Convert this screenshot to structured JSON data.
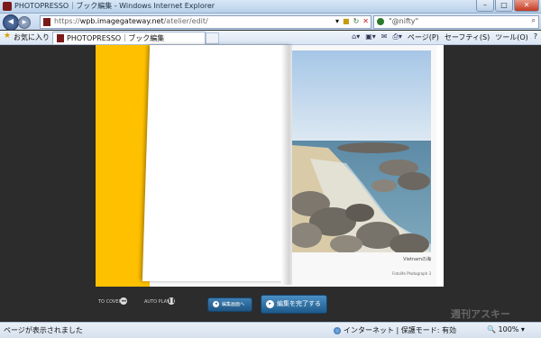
{
  "window": {
    "title": "PHOTOPRESSO｜ブック編集 - Windows Internet Explorer",
    "min_label": "–",
    "max_label": "□",
    "close_label": "✕"
  },
  "address": {
    "url_prefix": "https://",
    "url_domain": "wpb.imagegateway.net",
    "url_path": "/atelier/edit/"
  },
  "search": {
    "placeholder": "\"@nifty\""
  },
  "favorites": {
    "label": "お気に入り"
  },
  "tab": {
    "title": "PHOTOPRESSO｜ブック編集"
  },
  "commandbar": {
    "page": "ページ(P)",
    "safety": "セーフティ(S)",
    "tools": "ツール(O)",
    "help": "?"
  },
  "book": {
    "caption": "Vietnamの海",
    "credit": "Fotolife Photograph  3"
  },
  "controls": {
    "to_cover": "TO COVER",
    "auto_play": "AUTO PLAY",
    "edit_button": "編集画面へ",
    "done_button": "編集を完了する"
  },
  "status": {
    "message": "ページが表示されました",
    "zone": "インターネット | 保護モード: 有効",
    "zoom": "100%"
  },
  "watermark": "週刊アスキー",
  "colors": {
    "accent_yellow": "#ffc000",
    "button_blue": "#1f5584"
  }
}
